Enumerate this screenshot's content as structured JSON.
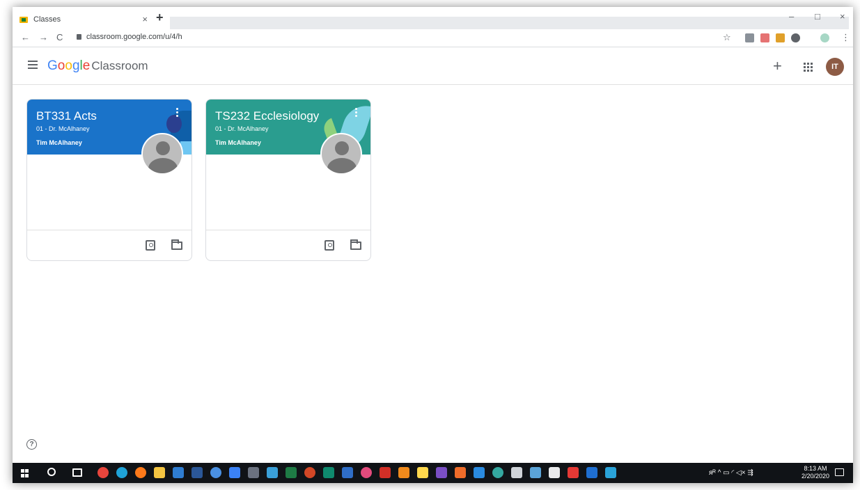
{
  "browser": {
    "tab_title": "Classes",
    "tab_close": "×",
    "new_tab": "+",
    "window_controls": {
      "minimize": "–",
      "maximize": "□",
      "close": "×"
    },
    "nav": {
      "back": "←",
      "forward": "→",
      "reload": "C"
    },
    "url": "classroom.google.com/u/4/h",
    "bookmark_icon": "☆"
  },
  "app": {
    "brand_google": [
      "G",
      "o",
      "o",
      "g",
      "l",
      "e"
    ],
    "brand_colors": [
      "#4285f4",
      "#ea4335",
      "#fbbc05",
      "#4285f4",
      "#34a853",
      "#ea4335"
    ],
    "brand_product": "Classroom",
    "add_button": "+",
    "avatar_initials": "IT",
    "avatar_color": "#8d5b45"
  },
  "classes": [
    {
      "title": "BT331 Acts",
      "section": "01 - Dr. McAlhaney",
      "teacher": "Tim McAlhaney",
      "color": "#1a73c9"
    },
    {
      "title": "TS232 Ecclesiology",
      "section": "01 - Dr. McAlhaney",
      "teacher": "Tim McAlhaney",
      "color": "#2a9d8f"
    }
  ],
  "help_icon": "?",
  "taskbar": {
    "tray_icons": "ᴙᴿ  ^  ▭  ◜  ◁×  ⇶",
    "clock_time": "8:13 AM",
    "clock_date": "2/20/2020"
  }
}
